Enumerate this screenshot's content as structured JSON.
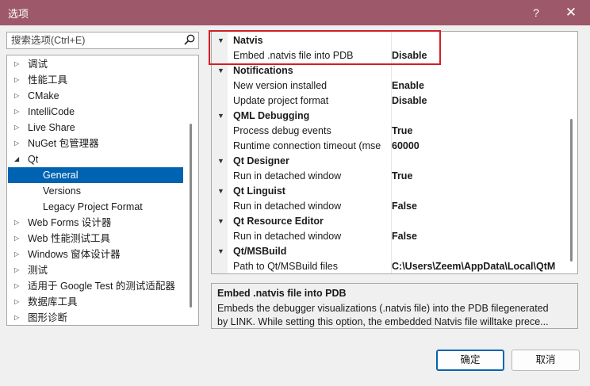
{
  "window": {
    "title": "选项",
    "help_glyph": "?",
    "close_glyph": "✕"
  },
  "search": {
    "placeholder": "搜索选项(Ctrl+E)"
  },
  "tree": {
    "items": [
      {
        "label": "调试",
        "expandable": true,
        "expanded": false,
        "indent": 0,
        "selected": false
      },
      {
        "label": "性能工具",
        "expandable": true,
        "expanded": false,
        "indent": 0,
        "selected": false
      },
      {
        "label": "CMake",
        "expandable": true,
        "expanded": false,
        "indent": 0,
        "selected": false
      },
      {
        "label": "IntelliCode",
        "expandable": true,
        "expanded": false,
        "indent": 0,
        "selected": false
      },
      {
        "label": "Live Share",
        "expandable": true,
        "expanded": false,
        "indent": 0,
        "selected": false
      },
      {
        "label": "NuGet 包管理器",
        "expandable": true,
        "expanded": false,
        "indent": 0,
        "selected": false
      },
      {
        "label": "Qt",
        "expandable": true,
        "expanded": true,
        "indent": 0,
        "selected": false
      },
      {
        "label": "General",
        "expandable": false,
        "expanded": false,
        "indent": 1,
        "selected": true
      },
      {
        "label": "Versions",
        "expandable": false,
        "expanded": false,
        "indent": 1,
        "selected": false
      },
      {
        "label": "Legacy Project Format",
        "expandable": false,
        "expanded": false,
        "indent": 1,
        "selected": false
      },
      {
        "label": "Web Forms 设计器",
        "expandable": true,
        "expanded": false,
        "indent": 0,
        "selected": false
      },
      {
        "label": "Web 性能测试工具",
        "expandable": true,
        "expanded": false,
        "indent": 0,
        "selected": false
      },
      {
        "label": "Windows 窗体设计器",
        "expandable": true,
        "expanded": false,
        "indent": 0,
        "selected": false
      },
      {
        "label": "测试",
        "expandable": true,
        "expanded": false,
        "indent": 0,
        "selected": false
      },
      {
        "label": "适用于 Google Test 的测试适配器",
        "expandable": true,
        "expanded": false,
        "indent": 0,
        "selected": false
      },
      {
        "label": "数据库工具",
        "expandable": true,
        "expanded": false,
        "indent": 0,
        "selected": false
      },
      {
        "label": "图形诊断",
        "expandable": true,
        "expanded": false,
        "indent": 0,
        "selected": false
      }
    ]
  },
  "properties": {
    "categories": [
      {
        "name": "Natvis",
        "props": [
          {
            "name": "Embed .natvis file into PDB",
            "value": "Disable"
          }
        ]
      },
      {
        "name": "Notifications",
        "props": [
          {
            "name": "New version installed",
            "value": "Enable"
          },
          {
            "name": "Update project format",
            "value": "Disable"
          }
        ]
      },
      {
        "name": "QML Debugging",
        "props": [
          {
            "name": "Process debug events",
            "value": "True"
          },
          {
            "name": "Runtime connection timeout (mse",
            "value": "60000"
          }
        ]
      },
      {
        "name": "Qt Designer",
        "props": [
          {
            "name": "Run in detached window",
            "value": "True"
          }
        ]
      },
      {
        "name": "Qt Linguist",
        "props": [
          {
            "name": "Run in detached window",
            "value": "False"
          }
        ]
      },
      {
        "name": "Qt Resource Editor",
        "props": [
          {
            "name": "Run in detached window",
            "value": "False"
          }
        ]
      },
      {
        "name": "Qt/MSBuild",
        "props": [
          {
            "name": "Path to Qt/MSBuild files",
            "value": "C:\\Users\\Zeem\\AppData\\Local\\QtM"
          }
        ]
      }
    ]
  },
  "description": {
    "title": "Embed .natvis file into PDB",
    "line1": "Embeds the debugger visualizations (.natvis file) into the PDB filegenerated",
    "line2": "by LINK. While setting this option, the embedded Natvis file willtake prece..."
  },
  "buttons": {
    "ok": "确定",
    "cancel": "取消"
  },
  "colors": {
    "titlebar": "#9d5969",
    "selection": "#0063b1",
    "highlight_box": "#d11f26"
  }
}
